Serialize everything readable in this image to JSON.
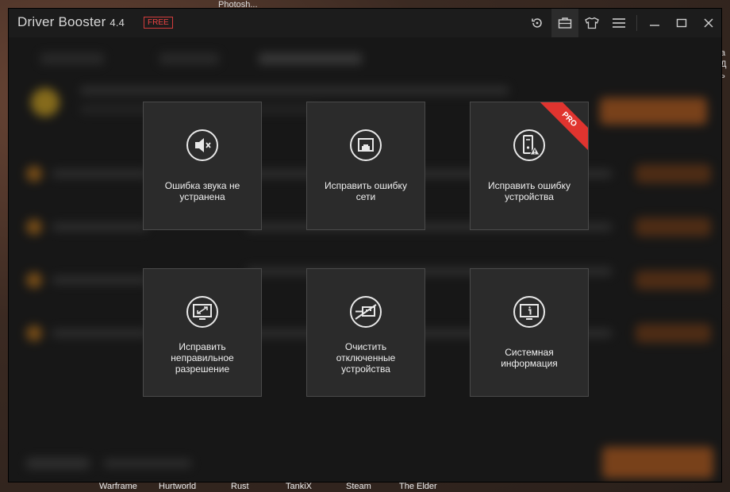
{
  "desktop": {
    "top_label": "Photosh...",
    "right_edge_text": "a\nД\nь",
    "taskbar_items": [
      "Warframe",
      "Hurtworld",
      "Rust",
      "TankiX",
      "Steam",
      "The Elder"
    ]
  },
  "window": {
    "title": "Driver Booster",
    "version": "4.4",
    "badge": "FREE",
    "toolbar_icons": [
      "restore-icon",
      "toolbox-icon",
      "skin-shirt-icon",
      "menu-icon"
    ],
    "window_controls": [
      "minimize-icon",
      "maximize-icon",
      "close-icon"
    ]
  },
  "tools": [
    {
      "label": "Ошибка звука не\nустранена",
      "icon": "sound-muted-icon",
      "pro": false
    },
    {
      "label": "Исправить ошибку\nсети",
      "icon": "network-icon",
      "pro": false
    },
    {
      "label": "Исправить ошибку\nустройства",
      "icon": "device-warning-icon",
      "pro": true,
      "pro_label": "PRO"
    },
    {
      "label": "Исправить\nнеправильное\nразрешение",
      "icon": "resolution-icon",
      "pro": false
    },
    {
      "label": "Очистить\nотключенные\nустройства",
      "icon": "disconnected-device-icon",
      "pro": false
    },
    {
      "label": "Системная\nинформация",
      "icon": "system-info-icon",
      "pro": false
    }
  ],
  "colors": {
    "accent_orange": "#c8641e",
    "pro_red": "#e0342f",
    "card_bg": "#2b2b2b",
    "window_bg": "#171717"
  }
}
